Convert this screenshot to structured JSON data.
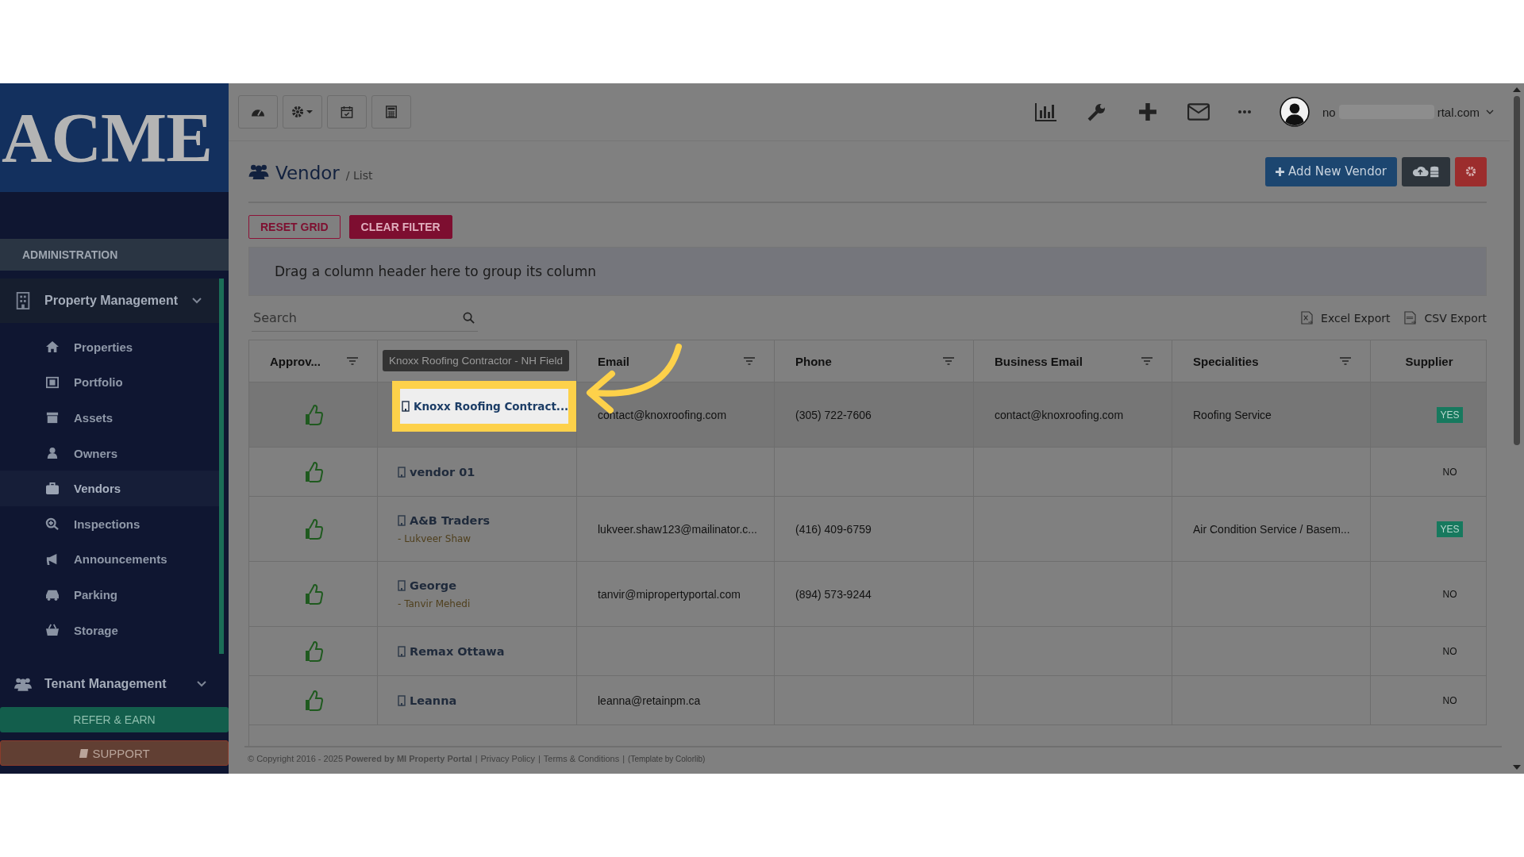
{
  "logo": "ACME",
  "sidebar": {
    "section": "ADMINISTRATION",
    "groups": [
      {
        "label": "Property Management",
        "expanded": true,
        "children": [
          {
            "label": "Properties",
            "selected": false
          },
          {
            "label": "Portfolio",
            "selected": false
          },
          {
            "label": "Assets",
            "selected": false
          },
          {
            "label": "Owners",
            "selected": false
          },
          {
            "label": "Vendors",
            "selected": true
          },
          {
            "label": "Inspections",
            "selected": false
          },
          {
            "label": "Announcements",
            "selected": false
          },
          {
            "label": "Parking",
            "selected": false
          },
          {
            "label": "Storage",
            "selected": false
          }
        ]
      },
      {
        "label": "Tenant Management",
        "expanded": false
      }
    ],
    "buttons": [
      {
        "label": "REFER & EARN",
        "kind": "refer"
      },
      {
        "label": "SUPPORT",
        "kind": "support"
      }
    ]
  },
  "user": {
    "email_start": "no",
    "email_end": "rtal.com"
  },
  "page": {
    "title": "Vendor",
    "breadcrumb": "/ List",
    "add_button": "Add New Vendor"
  },
  "grid": {
    "buttons": [
      {
        "label": "RESET GRID",
        "kind": "outline"
      },
      {
        "label": "CLEAR FILTER",
        "kind": "solid"
      }
    ],
    "group_hint": "Drag a column header here to group its column",
    "search": {
      "placeholder": "Search"
    },
    "exports": [
      {
        "label": "Excel Export",
        "kind": "excel"
      },
      {
        "label": "CSV Export",
        "kind": "csv"
      }
    ],
    "columns": [
      {
        "label": "Approv...",
        "filter": true
      },
      {
        "tooltip": "Knoxx Roofing Contractor - NH Field"
      },
      {
        "label": "Email",
        "filter": true
      },
      {
        "label": "Phone",
        "filter": true
      },
      {
        "label": "Business Email",
        "filter": true
      },
      {
        "label": "Specialities",
        "filter": true
      },
      {
        "label": "Supplier",
        "filter": false
      }
    ],
    "rows": [
      {
        "approved": true,
        "selected": true,
        "highlighted": true,
        "name": "Knoxx Roofing Contract...",
        "email": "contact@knoxroofing.com",
        "phone": "(305) 722-7606",
        "business_email": "contact@knoxroofing.com",
        "specialities": "Roofing Service",
        "supplier": true,
        "supplier_label": "YES"
      },
      {
        "approved": true,
        "selected": false,
        "highlighted": false,
        "name": "vendor 01",
        "supplier": false,
        "supplier_label": "NO"
      },
      {
        "approved": true,
        "selected": false,
        "highlighted": false,
        "name": "A&B Traders",
        "contact": "- Lukveer Shaw",
        "email": "lukveer.shaw123@mailinator.c...",
        "phone": "(416) 409-6759",
        "specialities": "Air Condition Service / Basem...",
        "supplier": true,
        "supplier_label": "YES"
      },
      {
        "approved": true,
        "selected": false,
        "highlighted": false,
        "name": "George",
        "contact": "- Tanvir Mehedi",
        "email": "tanvir@mipropertyportal.com",
        "phone": "(894) 573-9244",
        "supplier": false,
        "supplier_label": "NO"
      },
      {
        "approved": true,
        "selected": false,
        "highlighted": false,
        "name": "Remax Ottawa",
        "supplier": false,
        "supplier_label": "NO"
      },
      {
        "approved": true,
        "selected": false,
        "highlighted": false,
        "name": "Leanna",
        "email": "leanna@retainpm.ca",
        "supplier": false,
        "supplier_label": "NO"
      }
    ]
  },
  "footer": {
    "copyright": "© Copyright 2016 - 2025 **Powered by MI Property Portal**",
    "separator": "|",
    "links": [
      "Privacy Policy",
      "Terms & Conditions"
    ],
    "credit": "(Template by Colorlib)"
  }
}
